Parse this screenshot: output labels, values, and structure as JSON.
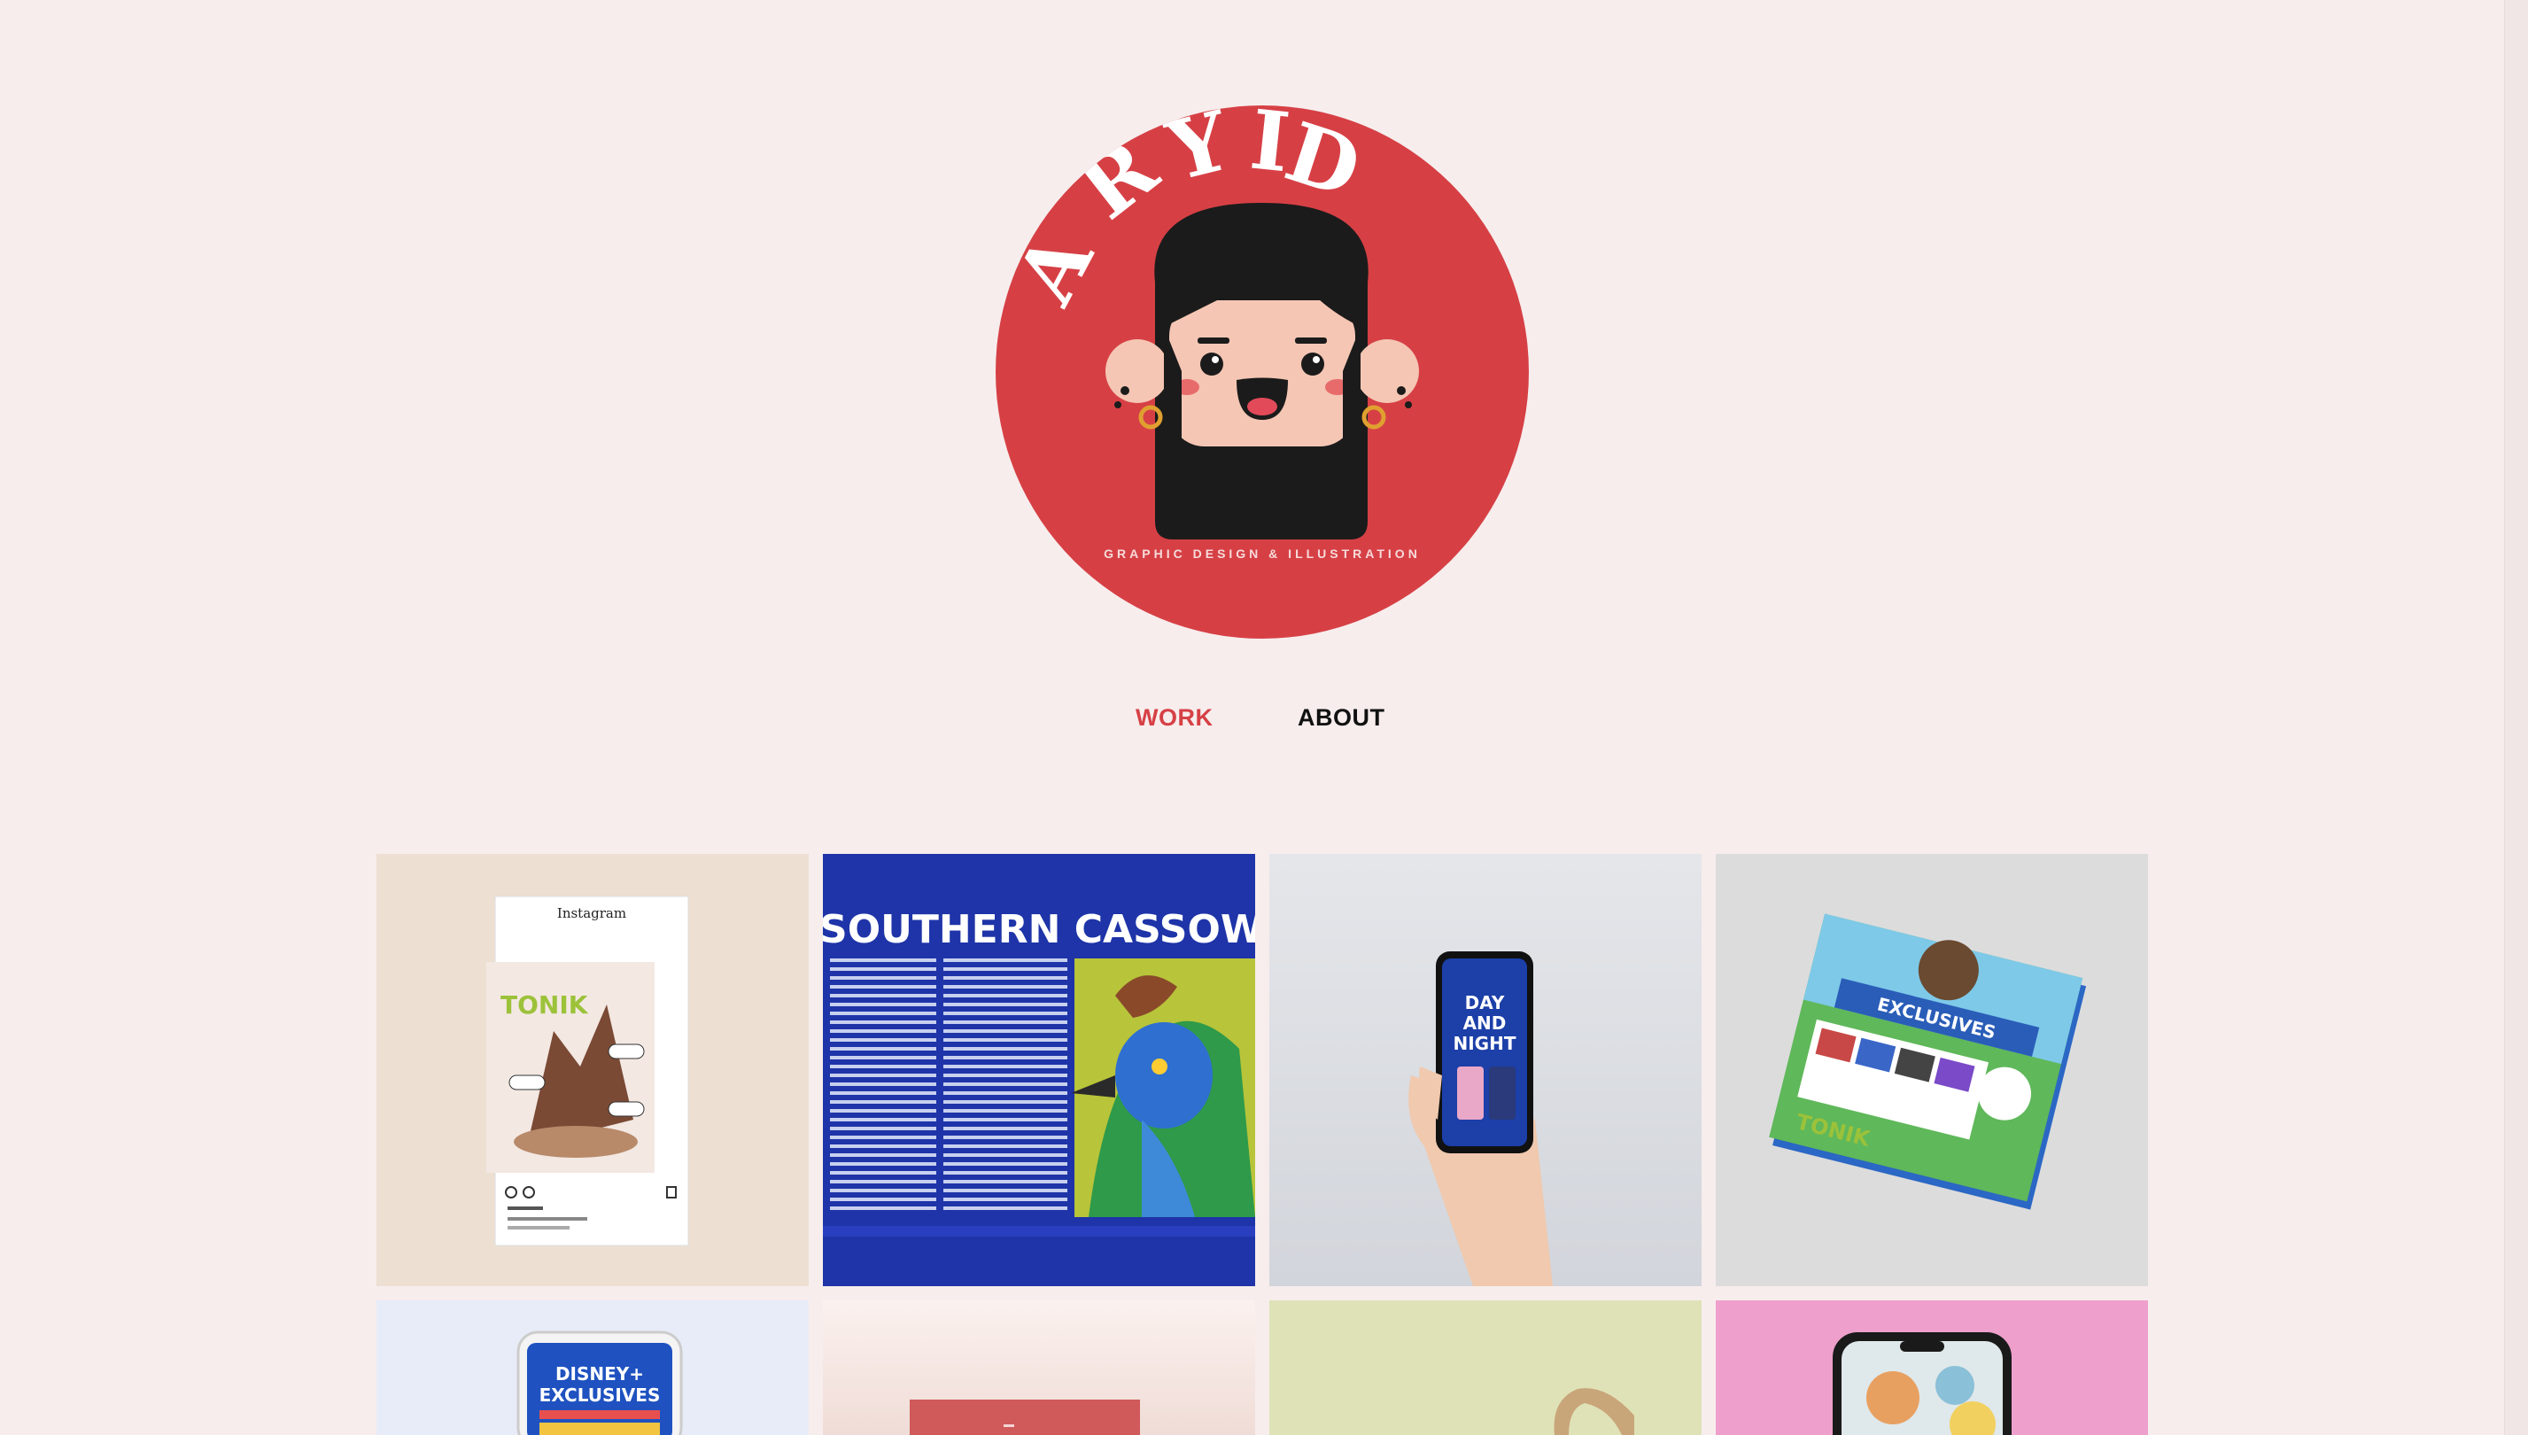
{
  "brand": {
    "logo_text": "ARYID",
    "tagline": "GRAPHIC DESIGN & ILLUSTRATION",
    "circle_color": "#d64045"
  },
  "nav": {
    "items": [
      {
        "label": "WORK",
        "active": true
      },
      {
        "label": "ABOUT",
        "active": false
      }
    ],
    "active_color": "#d64045"
  },
  "gallery": {
    "tiles": [
      {
        "name": "tonik-instagram-post",
        "texts": {
          "app": "Instagram",
          "brand": "TONIK"
        }
      },
      {
        "name": "southern-cassowary-spread",
        "texts": {
          "title": "SOUTHERN CASSOWARY"
        }
      },
      {
        "name": "day-and-night-phone",
        "texts": {
          "line1": "DAY",
          "line2": "AND",
          "line3": "NIGHT"
        }
      },
      {
        "name": "exclusives-flyer",
        "texts": {
          "headline": "EXCLUSIVES",
          "brand": "TONIK"
        }
      },
      {
        "name": "disney-exclusives-phone",
        "texts": {
          "line1": "DISNEY+",
          "line2": "EXCLUSIVES"
        }
      },
      {
        "name": "red-book-mockup",
        "texts": {}
      },
      {
        "name": "green-object-mockup",
        "texts": {}
      },
      {
        "name": "pink-phone-mockup",
        "texts": {}
      }
    ]
  }
}
